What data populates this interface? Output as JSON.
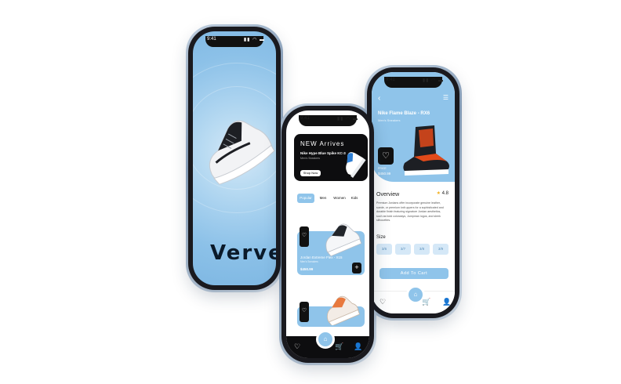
{
  "status": {
    "time": "9:41",
    "icons": "▮▮ ◠ ▬"
  },
  "splash": {
    "brand": "Verve"
  },
  "home": {
    "banner": {
      "title": "NEW Arrives",
      "name": "Nike Hype Blue Spike KC-3",
      "category": "Men's Sneakers",
      "button": "Shop Now"
    },
    "tabs": [
      "Popular",
      "Men",
      "Women",
      "Kids"
    ],
    "products": [
      {
        "name": "Jordan Extreme Flex - X15",
        "category": "Men's Sneakers",
        "price": "$450.99",
        "fav": "♡",
        "add": "+"
      },
      {
        "name": "",
        "category": "",
        "price": "",
        "fav": "♡",
        "add": ""
      }
    ],
    "nav": {
      "fav": "♡",
      "home": "⌂",
      "cart": "🛒",
      "profile": "👤"
    }
  },
  "detail": {
    "back": "‹",
    "menu": "☰",
    "title": "Nike Flame Blaze - RX6",
    "subtitle": "Men's Sneakers",
    "fav": "♡",
    "price_label": "PRICE",
    "price": "$450.99",
    "overview_title": "Overview",
    "rating": "4.8",
    "star": "★",
    "description": "Premium Jordans offer incorporate genuine leather, suede, or premium knit uppers for a sophisticated and durable finish featuring signature Jordan aesthetics, such as bold colorways, Jumpman logos, and sleek silhouettes.",
    "size_label": "Size",
    "sizes": [
      "3/6",
      "3/7",
      "3/8",
      "3/9"
    ],
    "add_to_cart": "Add To Cart",
    "nav": {
      "fav": "♡",
      "home": "⌂",
      "cart": "🛒",
      "profile": "👤"
    }
  },
  "colors": {
    "accent": "#8fc4ea",
    "dark": "#0d0d0f",
    "light": "#d5e8f7"
  }
}
